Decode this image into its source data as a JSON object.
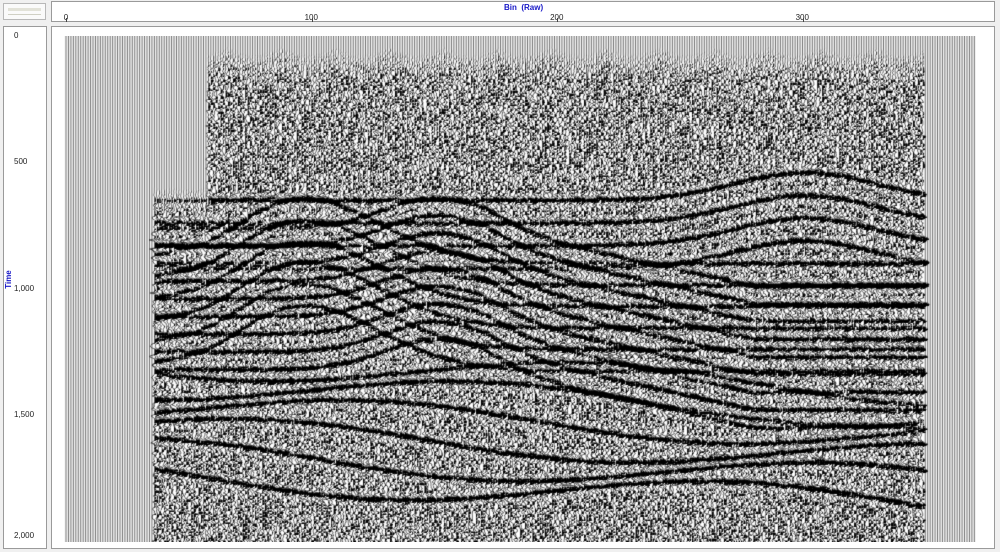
{
  "x_axis": {
    "title": "Bin  (Raw)",
    "ticks": [
      {
        "label": "0",
        "value": 0
      },
      {
        "label": "100",
        "value": 100
      },
      {
        "label": "200",
        "value": 200
      },
      {
        "label": "300",
        "value": 300
      }
    ],
    "range": [
      0,
      370
    ]
  },
  "y_axis": {
    "title": "Time",
    "ticks": [
      {
        "label": "0",
        "value": 0
      },
      {
        "label": "500",
        "value": 500
      },
      {
        "label": "1,000",
        "value": 1000
      },
      {
        "label": "1,500",
        "value": 1500
      },
      {
        "label": "2,000",
        "value": 2000
      }
    ],
    "range": [
      0,
      2000
    ]
  },
  "section": {
    "display": "wiggle-variable-area",
    "trace_color": "#000000",
    "background": "#ffffff",
    "data_start_bin": 36,
    "data_end_bin": 349
  }
}
